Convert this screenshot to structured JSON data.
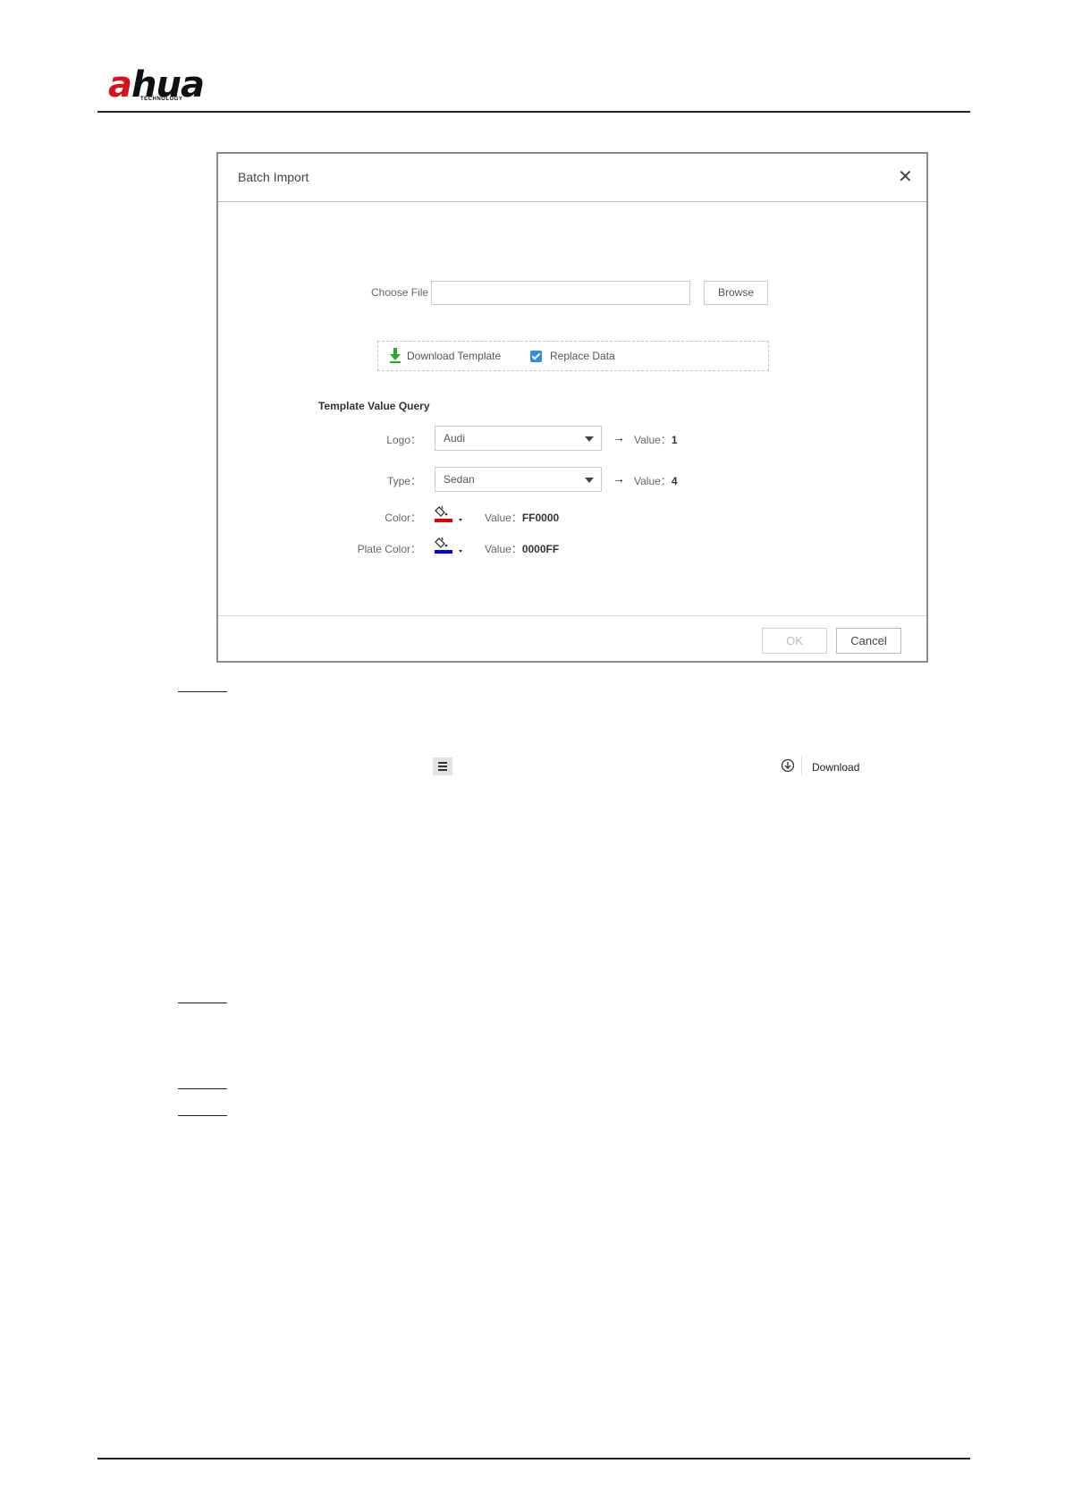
{
  "brand": {
    "name_a": "a",
    "name_rest": "hua",
    "tagline": "TECHNOLOGY",
    "accent": "#d8111b"
  },
  "dialog": {
    "title": "Batch Import",
    "close_glyph": "✕",
    "choose_file_label": "Choose File",
    "file_value": "",
    "browse_label": "Browse",
    "download_template_label": "Download Template",
    "replace_data_label": "Replace Data",
    "replace_data_checked": true,
    "template_query_title": "Template Value Query",
    "rows": {
      "logo": {
        "label": "Logo：",
        "selected": "Audi",
        "value_label": "Value：",
        "value": "1"
      },
      "type": {
        "label": "Type：",
        "selected": "Sedan",
        "value_label": "Value：",
        "value": "4"
      },
      "color": {
        "label": "Color：",
        "swatch": "#e00000",
        "value_label": "Value：",
        "value": "FF0000"
      },
      "plate_color": {
        "label": "Plate Color：",
        "swatch": "#0000ff",
        "value_label": "Value：",
        "value": "0000FF"
      }
    },
    "ok_label": "OK",
    "cancel_label": "Cancel"
  },
  "toolbar": {
    "menu_icon": "hamburger-menu-icon",
    "download_icon": "download-circle-icon",
    "download_label": "Download"
  },
  "colors": {
    "checkbox_blue": "#2d8cf0",
    "download_green": "#2aa830"
  }
}
